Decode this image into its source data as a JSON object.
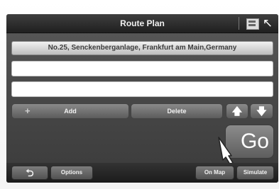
{
  "window": {
    "title": "Route Plan"
  },
  "header": {
    "screen_icon": "display-icon",
    "cursor_icon": "cursor-arrow-icon"
  },
  "route": {
    "start_address": "No.25, Senckenberganlage, Frankfurt am Main,Germany",
    "waypoints": [
      "",
      ""
    ]
  },
  "actions": {
    "add_label": "Add",
    "delete_label": "Delete",
    "up_glyph": "🡅",
    "down_glyph": "🡇",
    "go_label": "Go"
  },
  "bottom": {
    "back_glyph": "⮌",
    "options_label": "Options",
    "on_map_label": "On Map",
    "simulate_label": "Simulate"
  },
  "colors": {
    "screen_bg": "#4a4a4a",
    "titlebar_bg": "#1f1f1f",
    "button": "#6e6e6e",
    "text": "#f0f0f0"
  }
}
